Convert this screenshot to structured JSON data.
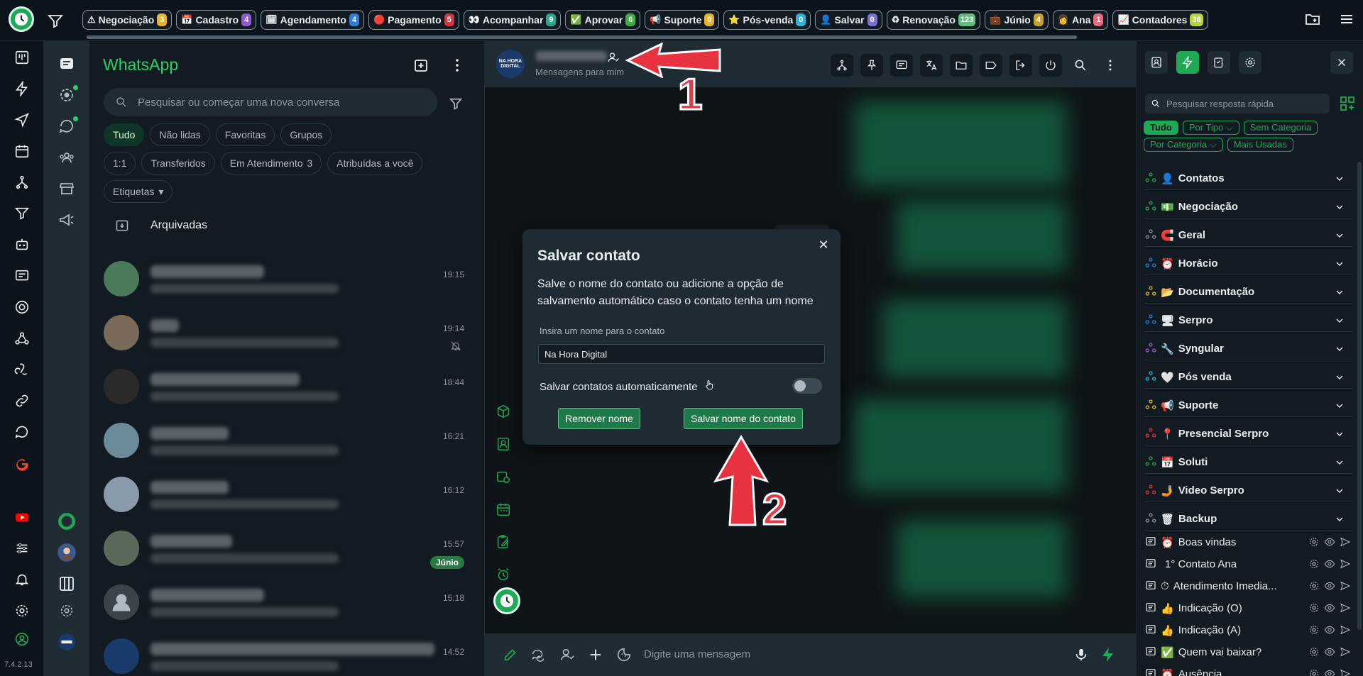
{
  "top_tags": [
    {
      "icon": "⚠",
      "label": "Negociação",
      "count": "3",
      "color": "#e8b52a"
    },
    {
      "icon": "📅",
      "label": "Cadastro",
      "count": "4",
      "color": "#8e5bd3"
    },
    {
      "icon": "🗓",
      "label": "Agendamento",
      "count": "4",
      "color": "#2f7fd8"
    },
    {
      "icon": "🔴",
      "label": "Pagamento",
      "count": "5",
      "color": "#d8343f"
    },
    {
      "icon": "👀",
      "label": "Acompanhar",
      "count": "9",
      "color": "#2ea88a"
    },
    {
      "icon": "✅",
      "label": "Aprovar",
      "count": "6",
      "color": "#3cb23c"
    },
    {
      "icon": "📢",
      "label": "Suporte",
      "count": "0",
      "color": "#e8b52a"
    },
    {
      "icon": "⭐",
      "label": "Pós-venda",
      "count": "0",
      "color": "#29b6d6"
    },
    {
      "icon": "👤",
      "label": "Salvar",
      "count": "0",
      "color": "#7a6fd3"
    },
    {
      "icon": "♻",
      "label": "Renovação",
      "count": "123",
      "color": "#5cbf7a"
    },
    {
      "icon": "💼",
      "label": "Júnio",
      "count": "4",
      "color": "#c9a227"
    },
    {
      "icon": "👩",
      "label": "Ana",
      "count": "1",
      "color": "#e36b7a"
    },
    {
      "icon": "📈",
      "label": "Contadores",
      "count": "36",
      "color": "#b5d53a"
    }
  ],
  "version": "7.4.2.13",
  "chat_panel": {
    "title": "WhatsApp",
    "search_placeholder": "Pesquisar ou começar uma nova conversa",
    "chips_row1": [
      "Tudo",
      "Não lidas",
      "Favoritas",
      "Grupos"
    ],
    "chips_row2": [
      {
        "label": "1:1"
      },
      {
        "label": "Transferidos"
      },
      {
        "label": "Em Atendimento",
        "count": "3"
      },
      {
        "label": "Atribuídas a você"
      }
    ],
    "etiquetas": "Etiquetas",
    "archived": "Arquivadas",
    "chats": [
      {
        "time": "19:15"
      },
      {
        "time": "19:14",
        "muted": true
      },
      {
        "time": "18:44"
      },
      {
        "time": "16:21"
      },
      {
        "time": "16:12"
      },
      {
        "time": "15:57",
        "label": "Júnio"
      },
      {
        "time": "15:18"
      },
      {
        "time": "14:52"
      }
    ]
  },
  "conversation": {
    "avatar_text": "NA HORA DIGITAL",
    "subtitle": "Mensagens para mim",
    "day_separator": "quarta-feira",
    "composer_placeholder": "Digite uma mensagem"
  },
  "modal": {
    "title": "Salvar contato",
    "description": "Salve o nome do contato ou adicione a opção de salvamento automático caso o contato tenha um nome",
    "input_label": "Insira um nome para o contato",
    "input_value": "Na Hora Digital",
    "auto_label": "Salvar contatos automaticamente",
    "auto_enabled": false,
    "remove_button": "Remover nome",
    "save_button": "Salvar nome do contato"
  },
  "annotations": {
    "step1": "1",
    "step2": "2"
  },
  "quick_replies": {
    "search_placeholder": "Pesquisar resposta rápida",
    "filters": [
      {
        "label": "Tudo",
        "active": true
      },
      {
        "label": "Por Tipo ⌵"
      },
      {
        "label": "Sem Categoria"
      },
      {
        "label": "Por Categoria ⌵"
      },
      {
        "label": "Mais Usadas"
      }
    ],
    "categories": [
      {
        "icon": "👤",
        "label": "Contatos"
      },
      {
        "icon": "💵",
        "label": "Negociação"
      },
      {
        "icon": "🧲",
        "label": "Geral"
      },
      {
        "icon": "⏰",
        "label": "Horácio"
      },
      {
        "icon": "📂",
        "label": "Documentação"
      },
      {
        "icon": "🖥",
        "label": "Serpro"
      },
      {
        "icon": "🔧",
        "label": "Syngular"
      },
      {
        "icon": "🤍",
        "label": "Pós venda"
      },
      {
        "icon": "📢",
        "label": "Suporte"
      },
      {
        "icon": "📍",
        "label": "Presencial Serpro"
      },
      {
        "icon": "📅",
        "label": "Soluti"
      },
      {
        "icon": "🤳",
        "label": "Video Serpro"
      },
      {
        "icon": "🗑",
        "label": "Backup"
      }
    ],
    "items": [
      {
        "icon": "⏰",
        "label": "Boas vindas"
      },
      {
        "icon": "",
        "label": "1° Contato Ana"
      },
      {
        "icon": "⏱",
        "label": "Atendimento Imedia..."
      },
      {
        "icon": "👍",
        "label": "Indicação (O)"
      },
      {
        "icon": "👍",
        "label": "Indicação (A)"
      },
      {
        "icon": "✅",
        "label": "Quem vai baixar?"
      },
      {
        "icon": "⏰",
        "label": "Ausência"
      }
    ]
  }
}
